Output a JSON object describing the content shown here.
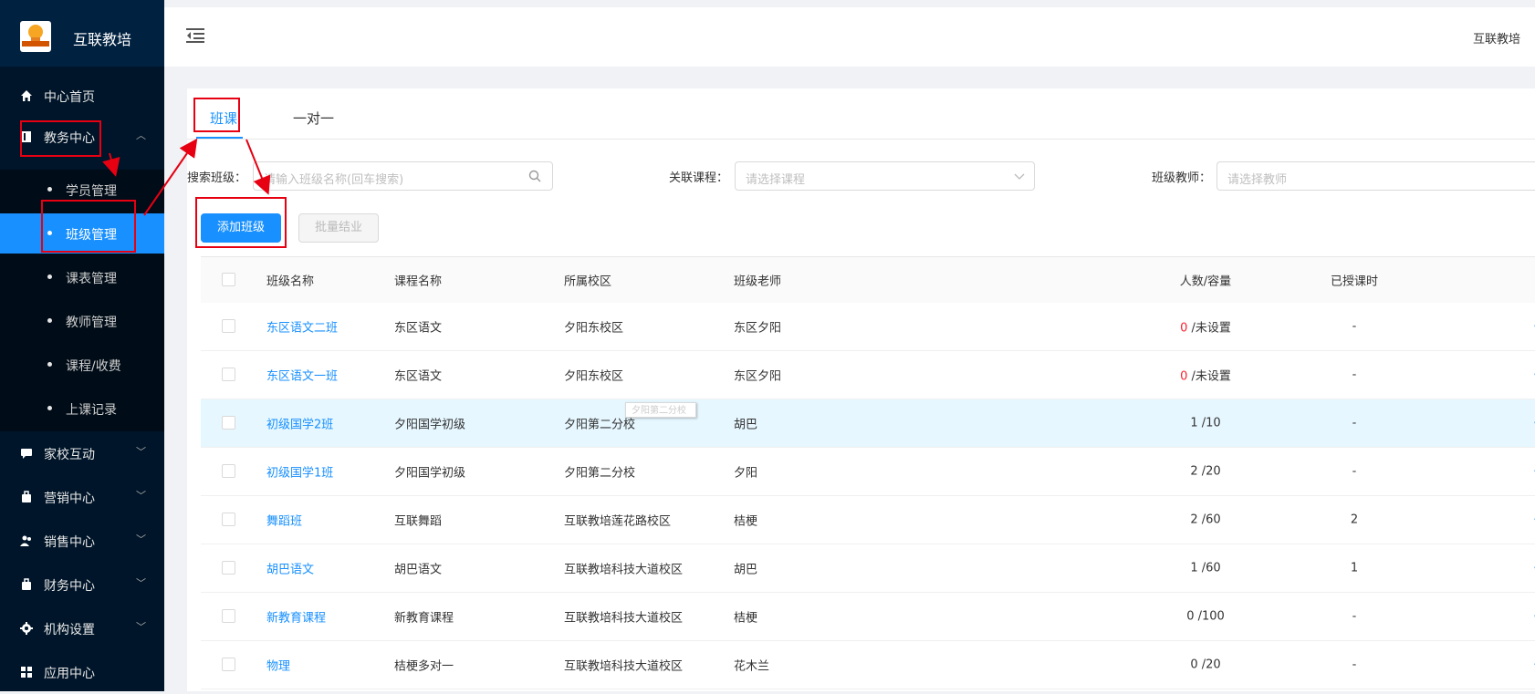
{
  "app": {
    "name": "互联教培"
  },
  "header": {
    "user": "互联教培"
  },
  "sidebar": {
    "items": [
      {
        "label": "中心首页",
        "icon": "home-icon"
      },
      {
        "label": "教务中心",
        "icon": "book-icon",
        "expanded": true
      },
      {
        "label": "家校互动",
        "icon": "chat-icon"
      },
      {
        "label": "营销中心",
        "icon": "bag-icon"
      },
      {
        "label": "销售中心",
        "icon": "users-icon"
      },
      {
        "label": "财务中心",
        "icon": "wallet-icon"
      },
      {
        "label": "机构设置",
        "icon": "gear-icon"
      },
      {
        "label": "应用中心",
        "icon": "grid-icon"
      }
    ],
    "sub_items": [
      {
        "label": "学员管理"
      },
      {
        "label": "班级管理",
        "active": true
      },
      {
        "label": "课表管理"
      },
      {
        "label": "教师管理"
      },
      {
        "label": "课程/收费"
      },
      {
        "label": "上课记录"
      }
    ]
  },
  "tabs": [
    {
      "label": "班课",
      "active": true
    },
    {
      "label": "一对一"
    }
  ],
  "filters": {
    "class": {
      "label": "搜索班级：",
      "placeholder": "请输入班级名称(回车搜索)"
    },
    "course": {
      "label": "关联课程：",
      "placeholder": "请选择课程"
    },
    "teacher": {
      "label": "班级教师：",
      "placeholder": "请选择教师"
    }
  },
  "buttons": {
    "add": "添加班级",
    "graduate": "批量结业"
  },
  "table": {
    "columns": [
      "班级名称",
      "课程名称",
      "所属校区",
      "班级老师",
      "人数/容量",
      "已授课时"
    ],
    "rows": [
      {
        "name": "东区语文二班",
        "course": "东区语文",
        "campus": "夕阳东校区",
        "teacher": "东区夕阳",
        "count": "0",
        "capacity": " /未设置",
        "hours": "-"
      },
      {
        "name": "东区语文一班",
        "course": "东区语文",
        "campus": "夕阳东校区",
        "teacher": "东区夕阳",
        "count": "0",
        "capacity": " /未设置",
        "hours": "-"
      },
      {
        "name": "初级国学2班",
        "course": "夕阳国学初级",
        "campus": "夕阳第二分校",
        "teacher": "胡巴",
        "count": "1",
        "capacity": " /10",
        "hours": "-"
      },
      {
        "name": "初级国学1班",
        "course": "夕阳国学初级",
        "campus": "夕阳第二分校",
        "teacher": "夕阳",
        "count": "2",
        "capacity": " /20",
        "hours": "-"
      },
      {
        "name": "舞蹈班",
        "course": "互联舞蹈",
        "campus": "互联教培莲花路校区",
        "teacher": "桔梗",
        "count": "2",
        "capacity": " /60",
        "hours": "2"
      },
      {
        "name": "胡巴语文",
        "course": "胡巴语文",
        "campus": "互联教培科技大道校区",
        "teacher": "胡巴",
        "count": "1",
        "capacity": " /60",
        "hours": "1"
      },
      {
        "name": "新教育课程",
        "course": "新教育课程",
        "campus": "互联教培科技大道校区",
        "teacher": "桔梗",
        "count": "0",
        "capacity": " /100",
        "hours": "-"
      },
      {
        "name": "物理",
        "course": "桔梗多对一",
        "campus": "互联教培科技大道校区",
        "teacher": "花木兰",
        "count": "0",
        "capacity": " /20",
        "hours": "-"
      }
    ],
    "tooltip": "夕阳第二分校"
  },
  "colors": {
    "accent": "#1890ff",
    "sidebar": "#001529",
    "annotation": "#e60012"
  }
}
